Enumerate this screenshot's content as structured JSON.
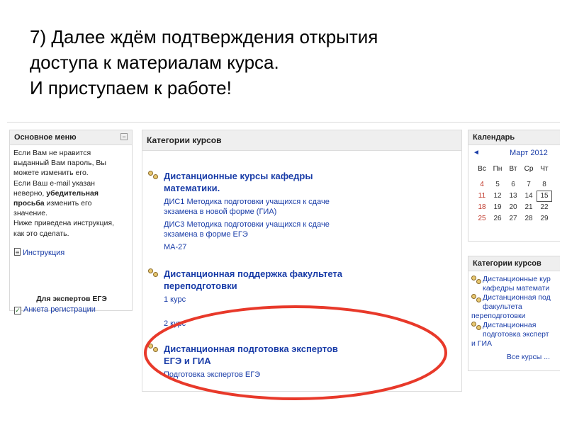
{
  "heading": {
    "line1": "7) Далее ждём подтверждения открытия",
    "line2": "доступа к материалам курса.",
    "line3": "И приступаем к работе!"
  },
  "main_menu": {
    "title": "Основное меню",
    "collapse_label": "−",
    "text_lines": [
      "Если Вам не нравится",
      "выданный Вам пароль, Вы",
      "можете изменить его.",
      "Если Ваш e-mail указан"
    ],
    "line5_prefix": "неверно, ",
    "line5_bold": "убедительная",
    "line6_bold": "просьба",
    "line6_suffix": " изменить его",
    "line7": "значение.",
    "line8": "Ниже приведена инструкция,",
    "line9": "как это сделать.",
    "instruction_link": "Инструкция",
    "experts_title": "Для экспертов ЕГЭ",
    "registration_link": "Анкета регистрации"
  },
  "course_categories": {
    "title": "Категории курсов",
    "categories": [
      {
        "title_line1": "Дистанционные курсы кафедры",
        "title_line2": "математики.",
        "courses": [
          "ДИС1 Методика подготовки учащихся к сдаче",
          "экзамена в новой форме (ГИА)",
          "ДИС3 Методика подготовки учащихся к сдаче",
          "экзамена в форме ЕГЭ",
          "МА-27"
        ]
      },
      {
        "title_line1": "Дистанционная поддержка факультета",
        "title_line2": "переподготовки",
        "courses": [
          "1 курс",
          "2 курс"
        ]
      },
      {
        "title_line1": "Дистанционная подготовка экспертов",
        "title_line2": "ЕГЭ и ГИА",
        "courses": [
          "Подготовка экспертов ЕГЭ"
        ]
      }
    ]
  },
  "calendar": {
    "title": "Календарь",
    "prev_arrow": "◄",
    "month": "Март 2012",
    "weekdays": [
      "Вс",
      "Пн",
      "Вт",
      "Ср",
      "Чт"
    ],
    "weeks": [
      [
        "4",
        "5",
        "6",
        "7",
        "8"
      ],
      [
        "11",
        "12",
        "13",
        "14",
        "15"
      ],
      [
        "18",
        "19",
        "20",
        "21",
        "22"
      ],
      [
        "25",
        "26",
        "27",
        "28",
        "29"
      ]
    ],
    "today": "15",
    "weekend_color": "#c0392b"
  },
  "right_categories": {
    "title": "Категории курсов",
    "items": [
      "Дистанционные кур",
      "кафедры математи",
      "Дистанционная под",
      "факультета",
      "переподготовки",
      "Дистанционная",
      "подготовка эксперт",
      "и ГИА"
    ],
    "all_courses": "Все курсы ..."
  },
  "annotation": {
    "color": "#e8392a"
  }
}
